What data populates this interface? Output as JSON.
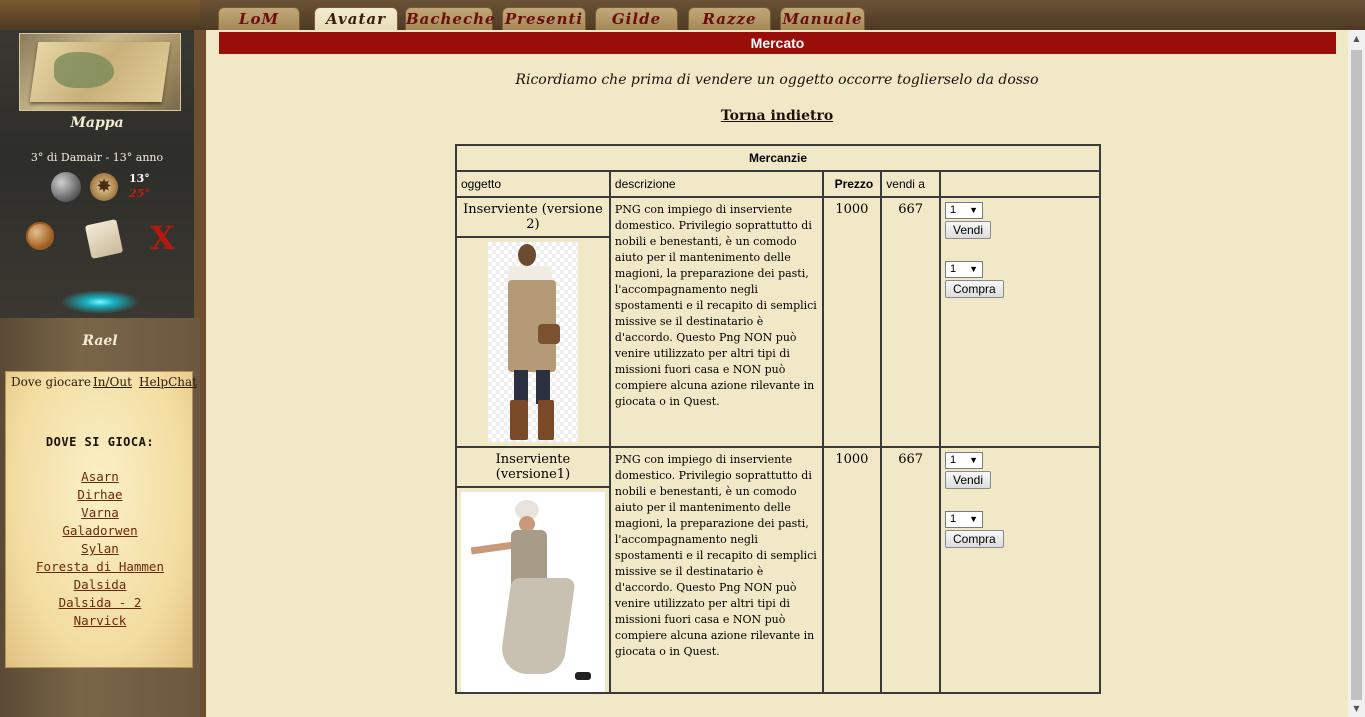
{
  "sidebar": {
    "map_label": "Mappa",
    "date": "3° di Damair - 13° anno",
    "temp_main": "13°",
    "temp_alt": "25°",
    "close_glyph": "X",
    "username": "Rael",
    "tabs": [
      "Dove giocare",
      "In/Out",
      "HelpChat"
    ],
    "where_heading": "DOVE SI GIOCA:",
    "locations": [
      "Asarn",
      "Dirhae",
      "Varna",
      "Galadorwen",
      "Sylan",
      "Foresta di Hammen",
      "Dalsida",
      "Dalsida - 2",
      "Narvick"
    ]
  },
  "nav": {
    "tabs": [
      "LoM",
      "Avatar",
      "Bacheche",
      "Presenti",
      "Gilde",
      "Razze",
      "Manuale"
    ],
    "active": "Avatar"
  },
  "main": {
    "title": "Mercato",
    "notice": "Ricordiamo che prima di vendere un oggetto occorre toglierselo da dosso",
    "back_link": "Torna indietro",
    "table": {
      "caption": "Mercanzie",
      "headers": [
        "oggetto",
        "descrizione",
        "Prezzo",
        "vendi a",
        ""
      ],
      "rows": [
        {
          "name": "Inserviente (versione 2)",
          "description": "PNG con impiego di inserviente domestico. Privilegio soprattutto di nobili e benestanti, è un comodo aiuto per il mantenimento delle magioni, la preparazione dei pasti, l'accompagnamento negli spostamenti e il recapito di semplici missive se il destinatario è d'accordo. Questo Png NON può venire utilizzato per altri tipi di missioni fuori casa e NON può compiere alcuna azione rilevante in giocata o in Quest.",
          "price": "1000",
          "sell_at": "667",
          "sell_qty": "1",
          "sell_label": "Vendi",
          "buy_qty": "1",
          "buy_label": "Compra"
        },
        {
          "name": "Inserviente (versione1)",
          "description": "PNG con impiego di inserviente domestico. Privilegio soprattutto di nobili e benestanti, è un comodo aiuto per il mantenimento delle magioni, la preparazione dei pasti, l'accompagnamento negli spostamenti e il recapito di semplici missive se il destinatario è d'accordo. Questo Png NON può venire utilizzato per altri tipi di missioni fuori casa e NON può compiere alcuna azione rilevante in giocata o in Quest.",
          "price": "1000",
          "sell_at": "667",
          "sell_qty": "1",
          "sell_label": "Vendi",
          "buy_qty": "1",
          "buy_label": "Compra"
        }
      ]
    }
  },
  "colors": {
    "title_bar": "#9a0e0a",
    "background": "#f0e8c6",
    "nav_text": "#6a0e0a",
    "link": "#6a2a0a"
  }
}
